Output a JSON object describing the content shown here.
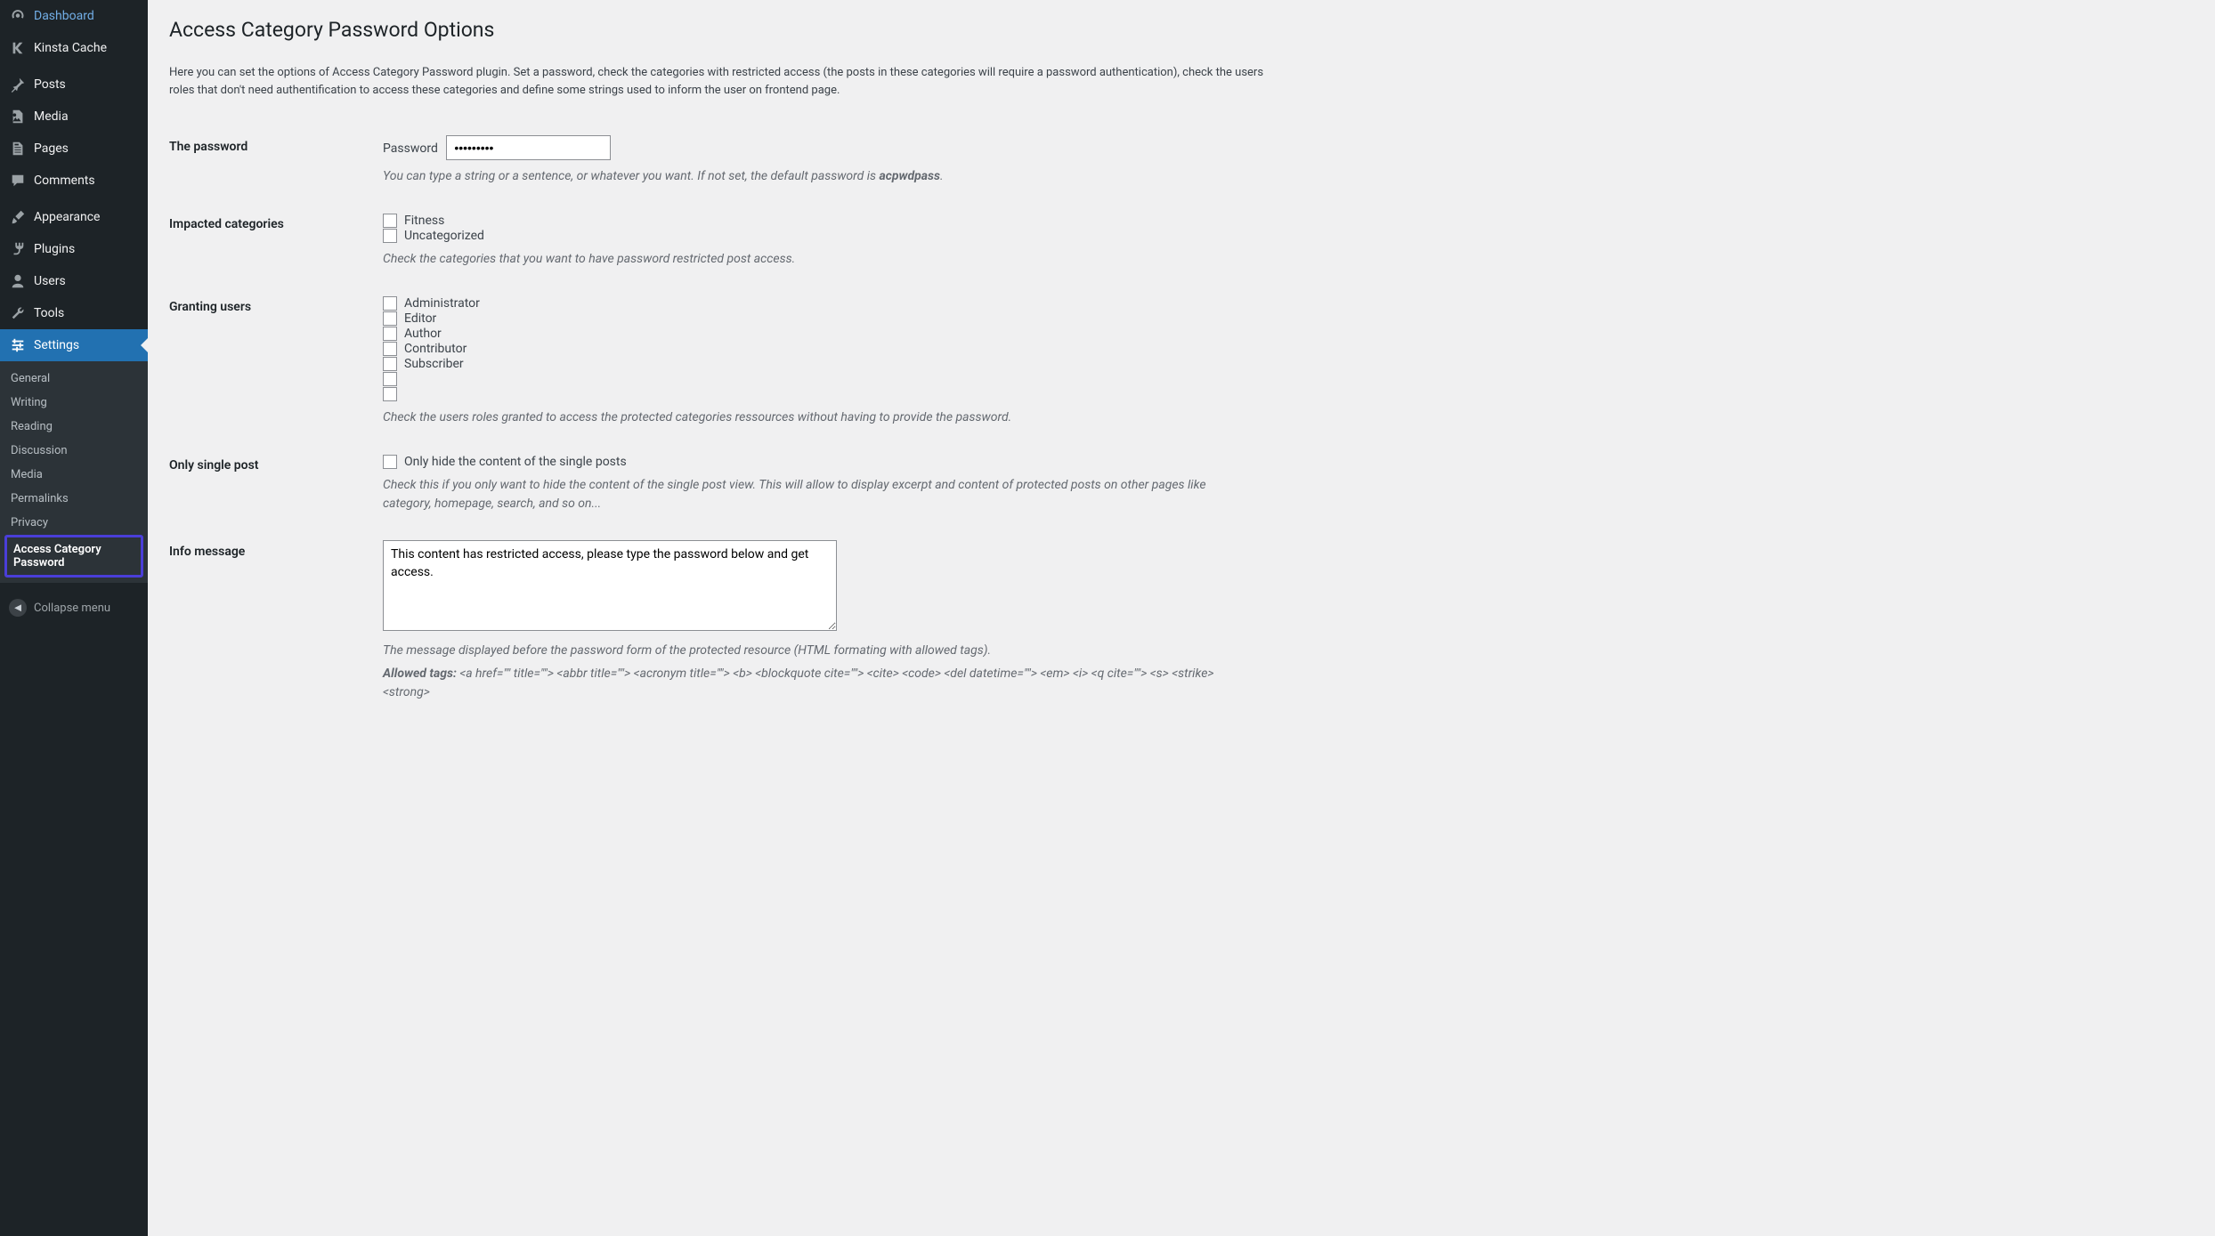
{
  "sidebar": {
    "main": [
      {
        "icon": "dashboard",
        "label": "Dashboard"
      },
      {
        "icon": "kinsta",
        "label": "Kinsta Cache"
      }
    ],
    "content_group": [
      {
        "icon": "pin",
        "label": "Posts"
      },
      {
        "icon": "media",
        "label": "Media"
      },
      {
        "icon": "page",
        "label": "Pages"
      },
      {
        "icon": "comment",
        "label": "Comments"
      }
    ],
    "admin_group": [
      {
        "icon": "brush",
        "label": "Appearance"
      },
      {
        "icon": "plug",
        "label": "Plugins"
      },
      {
        "icon": "user",
        "label": "Users"
      },
      {
        "icon": "wrench",
        "label": "Tools"
      },
      {
        "icon": "sliders",
        "label": "Settings",
        "active": true
      }
    ],
    "settings_sub": [
      {
        "label": "General"
      },
      {
        "label": "Writing"
      },
      {
        "label": "Reading"
      },
      {
        "label": "Discussion"
      },
      {
        "label": "Media"
      },
      {
        "label": "Permalinks"
      },
      {
        "label": "Privacy"
      },
      {
        "label": "Access Category Password",
        "current": true
      }
    ],
    "collapse": "Collapse menu"
  },
  "page": {
    "title": "Access Category Password Options",
    "intro": "Here you can set the options of Access Category Password plugin. Set a password, check the categories with restricted access (the posts in these categories will require a password authentication), check the users roles that don't need authentification to access these categories and define some strings used to inform the user on frontend page."
  },
  "form": {
    "password": {
      "heading": "The password",
      "label": "Password",
      "value": "•••••••••",
      "desc_before": "You can type a string or a sentence, or whatever you want. If not set, the default password is ",
      "desc_strong": "acpwdpass",
      "desc_after": "."
    },
    "categories": {
      "heading": "Impacted categories",
      "items": [
        "Fitness",
        "Uncategorized"
      ],
      "desc": "Check the categories that you want to have password restricted post access."
    },
    "granting": {
      "heading": "Granting users",
      "items": [
        "Administrator",
        "Editor",
        "Author",
        "Contributor",
        "Subscriber",
        "",
        ""
      ],
      "desc": "Check the users roles granted to access the protected categories ressources without having to provide the password."
    },
    "single": {
      "heading": "Only single post",
      "label": "Only hide the content of the single posts",
      "desc": "Check this if you only want to hide the content of the single post view. This will allow to display excerpt and content of protected posts on other pages like category, homepage, search, and so on..."
    },
    "info": {
      "heading": "Info message",
      "value": "This content has restricted access, please type the password below and get access.",
      "desc": "The message displayed before the password form of the protected resource (HTML formating with allowed tags).",
      "allowed_label": "Allowed tags:",
      "allowed_tags": "<a href=\"\" title=\"\"> <abbr title=\"\"> <acronym title=\"\"> <b> <blockquote cite=\"\"> <cite> <code> <del datetime=\"\"> <em> <i> <q cite=\"\"> <s> <strike> <strong>"
    }
  }
}
